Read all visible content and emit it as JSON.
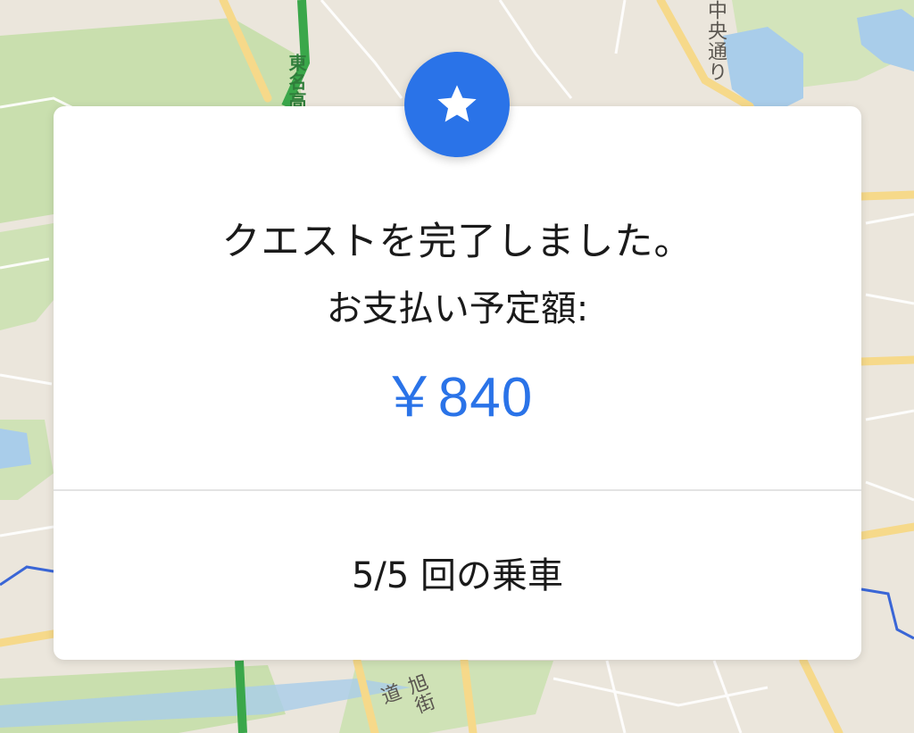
{
  "map": {
    "labels": {
      "expressway": "東名高",
      "avenue": "中央通り",
      "highway": "旭街道"
    }
  },
  "quest_card": {
    "badge_icon": "star-icon",
    "title": "クエストを完了しました。",
    "subtitle": "お支払い予定額:",
    "amount": "￥840",
    "rides_progress": "5/5 回の乗車"
  },
  "colors": {
    "accent": "#2a73e8",
    "card_background": "#ffffff",
    "text_primary": "#1a1a1a",
    "map_background": "#ebe6dc"
  }
}
